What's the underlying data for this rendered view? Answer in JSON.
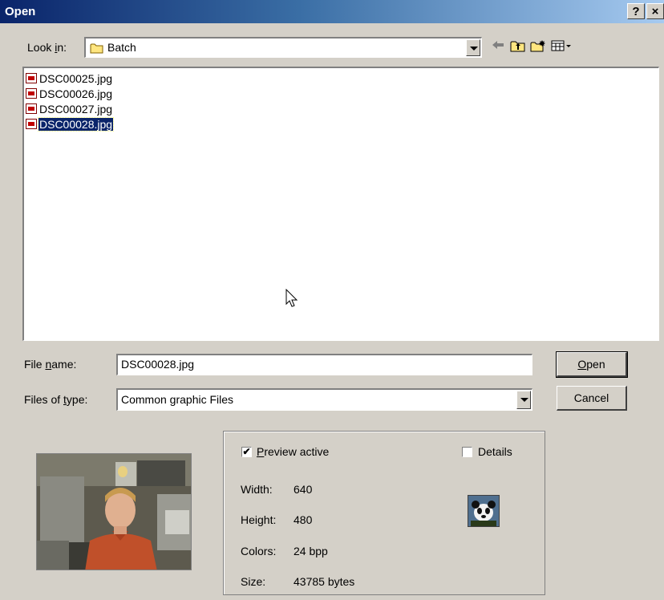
{
  "dialog": {
    "title": "Open",
    "help_label": "?",
    "close_label": "×"
  },
  "lookin": {
    "label_pre": "Look ",
    "label_key": "i",
    "label_post": "n:",
    "value": "Batch",
    "icons": [
      "back-icon",
      "up-folder-icon",
      "new-folder-icon",
      "view-menu-icon"
    ]
  },
  "files": [
    {
      "name": "DSC00025.jpg",
      "selected": false
    },
    {
      "name": "DSC00026.jpg",
      "selected": false
    },
    {
      "name": "DSC00027.jpg",
      "selected": false
    },
    {
      "name": "DSC00028.jpg",
      "selected": true
    }
  ],
  "filename": {
    "label_pre": "File ",
    "label_key": "n",
    "label_post": "ame:",
    "value": "DSC00028.jpg"
  },
  "filetype": {
    "label_pre": "Files of ",
    "label_key": "t",
    "label_post": "ype:",
    "value": "Common graphic Files"
  },
  "buttons": {
    "open_key": "O",
    "open_rest": "pen",
    "cancel": "Cancel"
  },
  "info": {
    "preview_key": "P",
    "preview_rest": "review active",
    "preview_checked": true,
    "details_label": "Details",
    "details_checked": false,
    "width_label": "Width:",
    "width_value": "640",
    "height_label": "Height:",
    "height_value": "480",
    "colors_label": "Colors:",
    "colors_value": "24 bpp",
    "size_label": "Size:",
    "size_value": "43785 bytes"
  },
  "colors": {
    "title_start": "#0a246a",
    "title_end": "#a6caf0",
    "dialog_bg": "#d4d0c8",
    "selection": "#0a246a"
  }
}
